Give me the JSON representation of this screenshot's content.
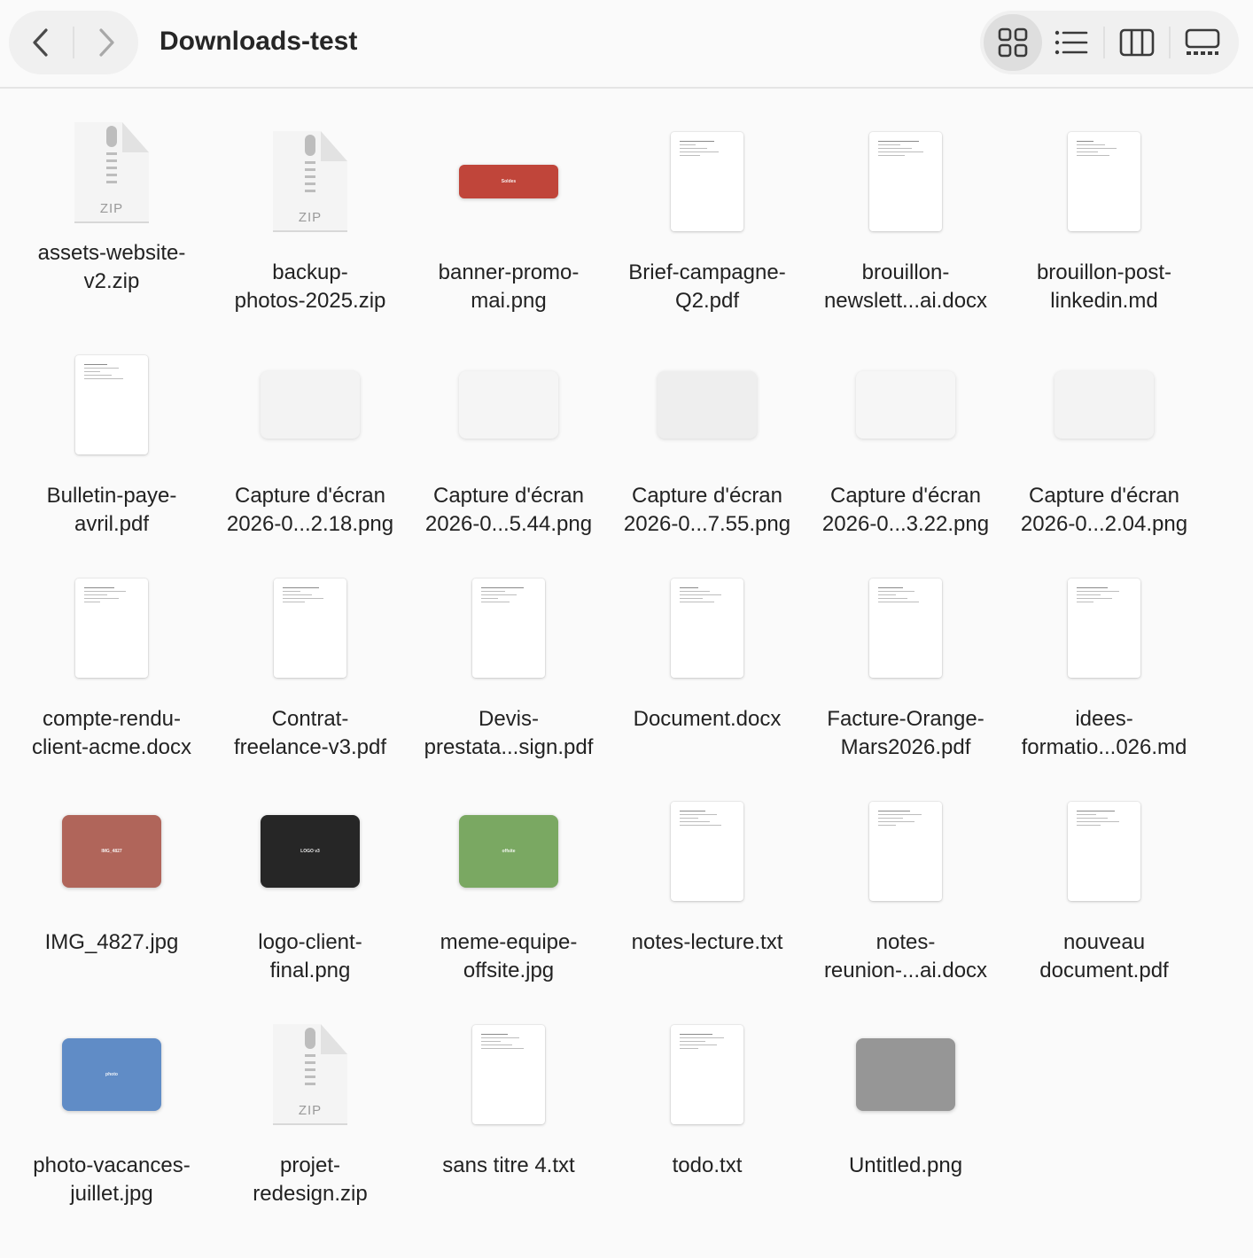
{
  "window": {
    "title": "Downloads-test"
  },
  "toolbar": {
    "back_icon": "chevron-left-icon",
    "forward_icon": "chevron-right-icon",
    "views": [
      "icon-view-icon",
      "list-view-icon",
      "column-view-icon",
      "gallery-view-icon"
    ],
    "active_view": "icon-view-icon"
  },
  "files": [
    {
      "label": "assets-website-\nv2.zip",
      "kind": "zip",
      "badge": "ZIP"
    },
    {
      "label": "backup-\nphotos-2025.zip",
      "kind": "zip",
      "badge": "ZIP"
    },
    {
      "label": "banner-promo-\nmai.png",
      "kind": "image",
      "color": "#c0453a",
      "text": "Soldes",
      "shape": "banner"
    },
    {
      "label": "Brief-campagne-\nQ2.pdf",
      "kind": "doc"
    },
    {
      "label": "brouillon-\nnewslett...ai.docx",
      "kind": "doc"
    },
    {
      "label": "brouillon-post-\nlinkedin.md",
      "kind": "doc"
    },
    {
      "label": "Bulletin-paye-\navril.pdf",
      "kind": "doc"
    },
    {
      "label": "Capture d'écran\n2026-0...2.18.png",
      "kind": "image",
      "color": "#f3f3f3",
      "text": "",
      "shape": "screen"
    },
    {
      "label": "Capture d'écran\n2026-0...5.44.png",
      "kind": "image",
      "color": "#f5f5f5",
      "text": "",
      "shape": "screen"
    },
    {
      "label": "Capture d'écran\n2026-0...7.55.png",
      "kind": "image",
      "color": "#eeeeee",
      "text": "",
      "shape": "screen"
    },
    {
      "label": "Capture d'écran\n2026-0...3.22.png",
      "kind": "image",
      "color": "#f6f6f6",
      "text": "",
      "shape": "screen"
    },
    {
      "label": "Capture d'écran\n2026-0...2.04.png",
      "kind": "image",
      "color": "#f3f3f3",
      "text": "",
      "shape": "screen"
    },
    {
      "label": "compte-rendu-\nclient-acme.docx",
      "kind": "doc"
    },
    {
      "label": "Contrat-\nfreelance-v3.pdf",
      "kind": "doc"
    },
    {
      "label": "Devis-\nprestata...sign.pdf",
      "kind": "doc"
    },
    {
      "label": "Document.docx",
      "kind": "doc"
    },
    {
      "label": "Facture-Orange-\nMars2026.pdf",
      "kind": "doc"
    },
    {
      "label": "idees-\nformatio...026.md",
      "kind": "doc"
    },
    {
      "label": "IMG_4827.jpg",
      "kind": "image",
      "color": "#b0655a",
      "text": "IMG_4827",
      "shape": "photo"
    },
    {
      "label": "logo-client-\nfinal.png",
      "kind": "image",
      "color": "#262626",
      "text": "LOGO v3",
      "shape": "photo"
    },
    {
      "label": "meme-equipe-\noffsite.jpg",
      "kind": "image",
      "color": "#7aa862",
      "text": "offsite",
      "shape": "photo"
    },
    {
      "label": "notes-lecture.txt",
      "kind": "doc"
    },
    {
      "label": "notes-\nreunion-...ai.docx",
      "kind": "doc"
    },
    {
      "label": "nouveau\ndocument.pdf",
      "kind": "doc"
    },
    {
      "label": "photo-vacances-\njuillet.jpg",
      "kind": "image",
      "color": "#608cc6",
      "text": "photo",
      "shape": "photo"
    },
    {
      "label": "projet-\nredesign.zip",
      "kind": "zip",
      "badge": "ZIP"
    },
    {
      "label": "sans titre 4.txt",
      "kind": "doc"
    },
    {
      "label": "todo.txt",
      "kind": "doc"
    },
    {
      "label": "Untitled.png",
      "kind": "image",
      "color": "#969696",
      "text": "",
      "shape": "photo"
    }
  ]
}
